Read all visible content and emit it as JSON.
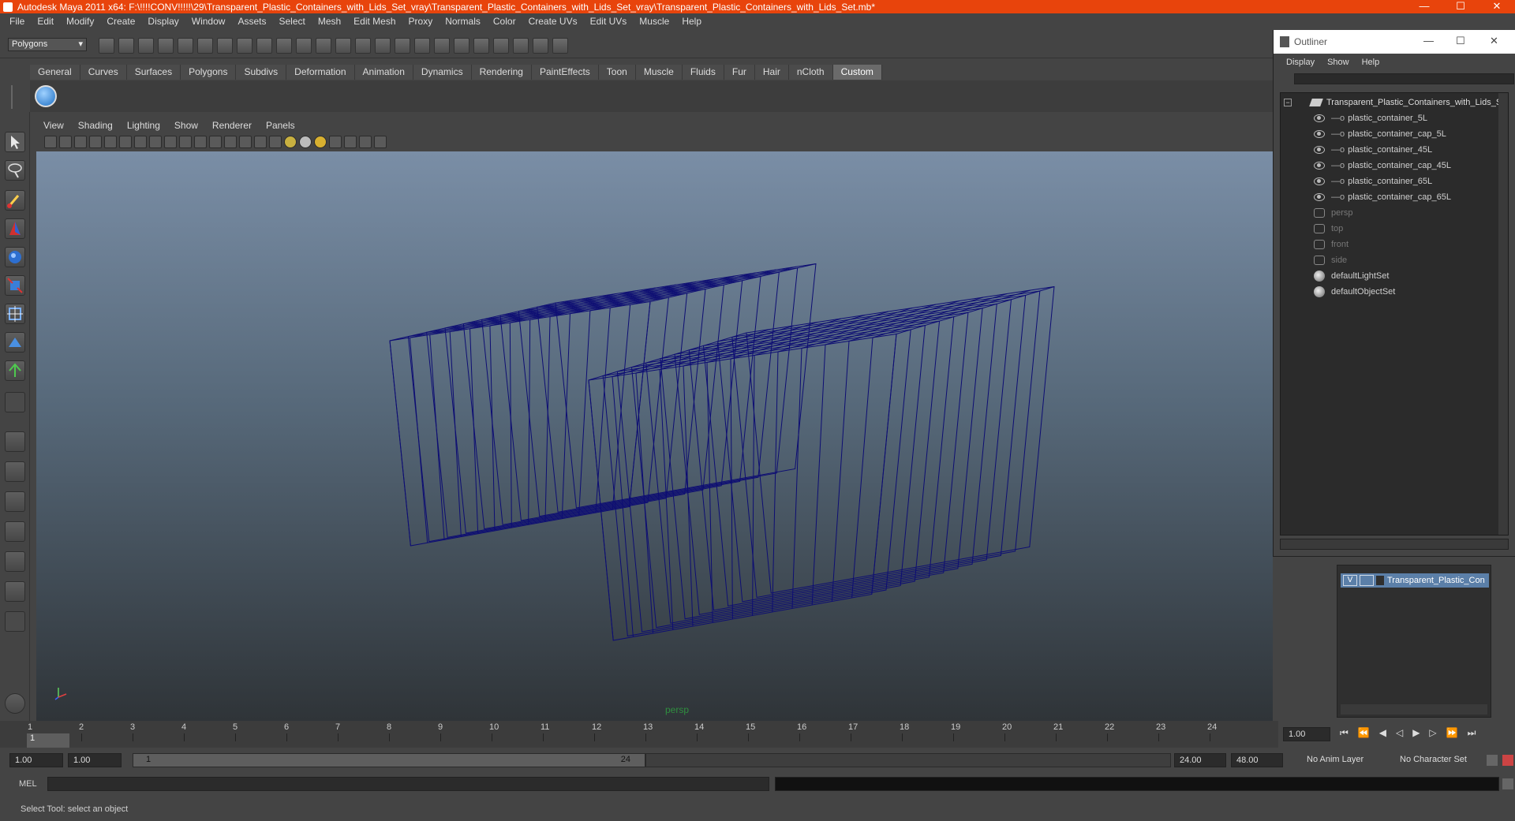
{
  "window": {
    "title": "Autodesk Maya 2011 x64: F:\\!!!!CONV!!!!!\\29\\Transparent_Plastic_Containers_with_Lids_Set_vray\\Transparent_Plastic_Containers_with_Lids_Set_vray\\Transparent_Plastic_Containers_with_Lids_Set.mb*",
    "minimize": "—",
    "maximize": "☐",
    "close": "✕"
  },
  "menubar": [
    "File",
    "Edit",
    "Modify",
    "Create",
    "Display",
    "Window",
    "Assets",
    "Select",
    "Mesh",
    "Edit Mesh",
    "Proxy",
    "Normals",
    "Color",
    "Create UVs",
    "Edit UVs",
    "Muscle",
    "Help"
  ],
  "mode_selector": "Polygons",
  "shelf_tabs": [
    "General",
    "Curves",
    "Surfaces",
    "Polygons",
    "Subdivs",
    "Deformation",
    "Animation",
    "Dynamics",
    "Rendering",
    "PaintEffects",
    "Toon",
    "Muscle",
    "Fluids",
    "Fur",
    "Hair",
    "nCloth",
    "Custom"
  ],
  "active_shelf_tab": "Custom",
  "panel_menu": [
    "View",
    "Shading",
    "Lighting",
    "Show",
    "Renderer",
    "Panels"
  ],
  "viewport": {
    "camera_label": "persp",
    "wire_color": "#0d0d73"
  },
  "outliner": {
    "title": "Outliner",
    "menu": [
      "Display",
      "Show",
      "Help"
    ],
    "root": "Transparent_Plastic_Containers_with_Lids_S",
    "children": [
      "plastic_container_5L",
      "plastic_container_cap_5L",
      "plastic_container_45L",
      "plastic_container_cap_45L",
      "plastic_container_65L",
      "plastic_container_cap_65L"
    ],
    "cameras": [
      "persp",
      "top",
      "front",
      "side"
    ],
    "sets": [
      "defaultLightSet",
      "defaultObjectSet"
    ]
  },
  "layer_editor": {
    "layer_visible": "V",
    "layer_name": "Transparent_Plastic_Con"
  },
  "timeslider": {
    "ticks": [
      "1",
      "2",
      "3",
      "4",
      "5",
      "6",
      "7",
      "8",
      "9",
      "10",
      "11",
      "12",
      "13",
      "14",
      "15",
      "16",
      "17",
      "18",
      "19",
      "20",
      "21",
      "22",
      "23",
      "24"
    ],
    "current_frame": "1",
    "current_time_field": "1.00"
  },
  "range_slider": {
    "start_time": "1.00",
    "playback_start": "1.00",
    "range_start_label": "1",
    "range_end_label": "24",
    "playback_end": "24.00",
    "end_time": "48.00",
    "anim_layer": "No Anim Layer",
    "character_set": "No Character Set"
  },
  "command_line": {
    "label": "MEL"
  },
  "help_line": "Select Tool: select an object"
}
